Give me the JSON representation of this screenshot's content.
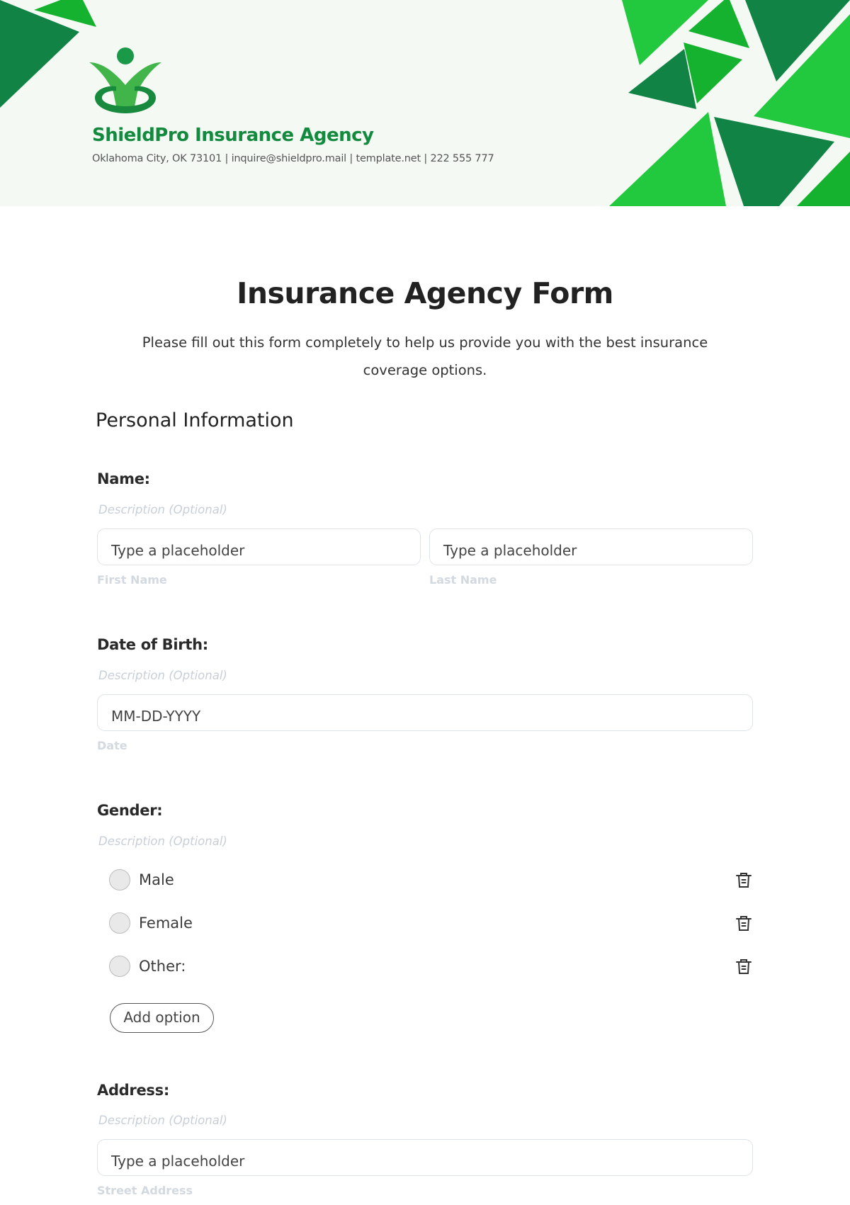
{
  "header": {
    "company_name": "ShieldPro Insurance Agency",
    "contact": "Oklahoma City, OK 73101 | inquire@shieldpro.mail | template.net | 222 555 777",
    "logo_icon": "person-with-ripple-logo",
    "colors": {
      "brand_green": "#138a3e",
      "bright_green": "#22c83e",
      "mid_green": "#14b22e",
      "dark_green": "#118344",
      "header_bg": "#f4f9f4"
    }
  },
  "form": {
    "title": "Insurance Agency Form",
    "subtitle": "Please fill out this form completely to help us provide you with the best insurance coverage options.",
    "section_title": "Personal Information",
    "fields": {
      "name": {
        "label": "Name:",
        "description": "Description (Optional)",
        "first_placeholder": "Type a placeholder",
        "first_sublabel": "First Name",
        "last_placeholder": "Type a placeholder",
        "last_sublabel": "Last Name"
      },
      "dob": {
        "label": "Date of Birth:",
        "description": "Description (Optional)",
        "placeholder": "MM-DD-YYYY",
        "sublabel": "Date"
      },
      "gender": {
        "label": "Gender:",
        "description": "Description (Optional)",
        "options": [
          "Male",
          "Female",
          "Other:"
        ],
        "delete_icon": "trash-icon",
        "add_option_label": "Add option"
      },
      "address": {
        "label": "Address:",
        "description": "Description (Optional)",
        "placeholder": "Type a placeholder",
        "sublabel": "Street Address"
      }
    }
  }
}
